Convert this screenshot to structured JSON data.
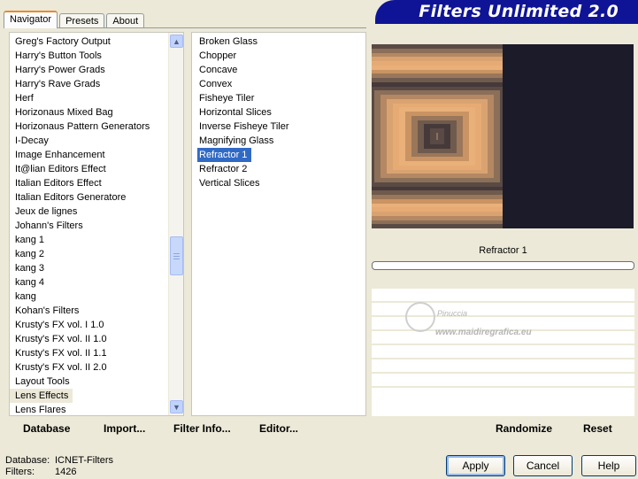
{
  "tabs": [
    "Navigator",
    "Presets",
    "About"
  ],
  "brand": "Filters Unlimited 2.0",
  "categories": [
    "Greg's Factory Output",
    "Harry's Button Tools",
    "Harry's Power Grads",
    "Harry's Rave Grads",
    "Herf",
    "Horizonaus Mixed Bag",
    "Horizonaus Pattern Generators",
    "I-Decay",
    "Image Enhancement",
    "It@lian Editors Effect",
    "Italian Editors Effect",
    "Italian Editors Generatore",
    "Jeux de lignes",
    "Johann's Filters",
    "kang 1",
    "kang 2",
    "kang 3",
    "kang 4",
    "kang",
    "Kohan's Filters",
    "Krusty's FX vol. I 1.0",
    "Krusty's FX vol. II 1.0",
    "Krusty's FX vol. II 1.1",
    "Krusty's FX vol. II 2.0",
    "Layout Tools",
    "Lens Effects",
    "Lens Flares"
  ],
  "categories_highlighted": "Lens Effects",
  "filters": [
    "Broken Glass",
    "Chopper",
    "Concave",
    "Convex",
    "Fisheye Tiler",
    "Horizontal Slices",
    "Inverse Fisheye Tiler",
    "Magnifying Glass",
    "Refractor 1",
    "Refractor 2",
    "Vertical Slices"
  ],
  "filters_selected": "Refractor 1",
  "preview_filter_name": "Refractor 1",
  "watermark": {
    "line1": "Pinuccia",
    "line2": "www.maidiregrafica.eu"
  },
  "toolbar": {
    "database": "Database",
    "import": "Import...",
    "filter_info": "Filter Info...",
    "editor": "Editor...",
    "randomize": "Randomize",
    "reset": "Reset"
  },
  "status": {
    "database_label": "Database:",
    "database_value": "ICNET-Filters",
    "filters_label": "Filters:",
    "filters_value": "1426"
  },
  "buttons": {
    "apply": "Apply",
    "cancel": "Cancel",
    "help": "Help"
  },
  "colors": {
    "brand_bg": "#0f1496",
    "selection": "#316ac5",
    "preview_dark": "#1c1b2a",
    "preview_peach": "#e6ab75",
    "preview_brown": "#8c6f58"
  }
}
